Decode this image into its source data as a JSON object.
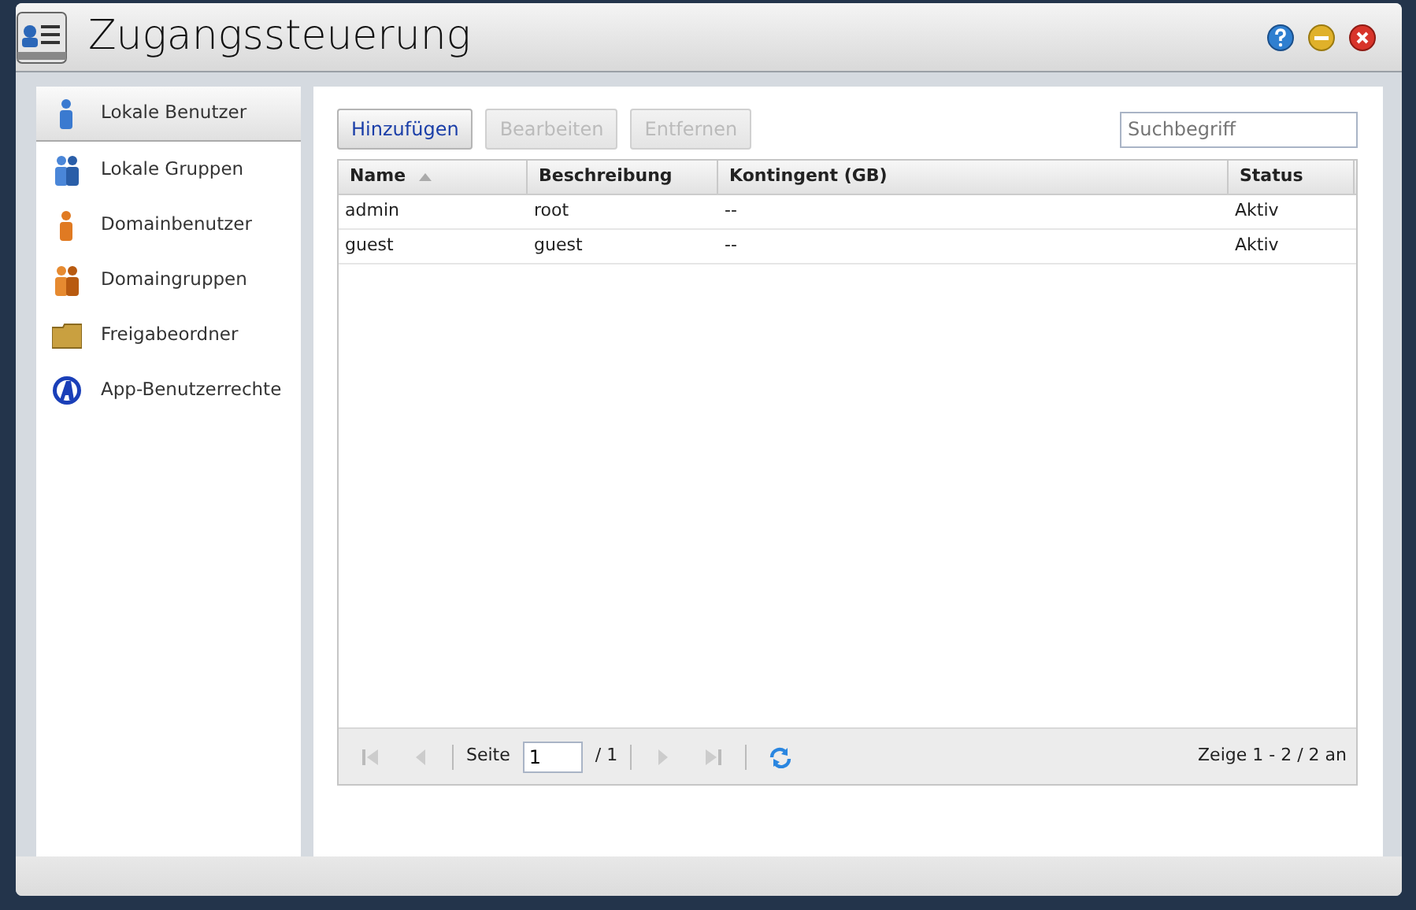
{
  "window": {
    "title": "Zugangssteuerung"
  },
  "sidebar": {
    "items": [
      {
        "label": "Lokale Benutzer",
        "kind": "user",
        "selected": true
      },
      {
        "label": "Lokale Gruppen",
        "kind": "group",
        "selected": false
      },
      {
        "label": "Domainbenutzer",
        "kind": "domain-user",
        "selected": false
      },
      {
        "label": "Domaingruppen",
        "kind": "domain-group",
        "selected": false
      },
      {
        "label": "Freigabeordner",
        "kind": "folder",
        "selected": false
      },
      {
        "label": "App-Benutzerrechte",
        "kind": "app",
        "selected": false
      }
    ]
  },
  "toolbar": {
    "buttons": [
      {
        "label": "Hinzufügen",
        "disabled": false
      },
      {
        "label": "Bearbeiten",
        "disabled": true
      },
      {
        "label": "Entfernen",
        "disabled": true
      }
    ],
    "search": {
      "placeholder": "Suchbegriff"
    }
  },
  "table": {
    "columns": [
      {
        "label": "Name",
        "sorted": true
      },
      {
        "label": "Beschreibung"
      },
      {
        "label": "Kontingent (GB)"
      },
      {
        "label": "Status"
      }
    ],
    "rows": [
      [
        "admin",
        "root",
        "--",
        "Aktiv"
      ],
      [
        "guest",
        "guest",
        "--",
        "Aktiv"
      ]
    ]
  },
  "pager": {
    "page_label": "Seite",
    "page": "1",
    "of": "/ 1",
    "summary": "Zeige 1 - 2 / 2 an"
  }
}
